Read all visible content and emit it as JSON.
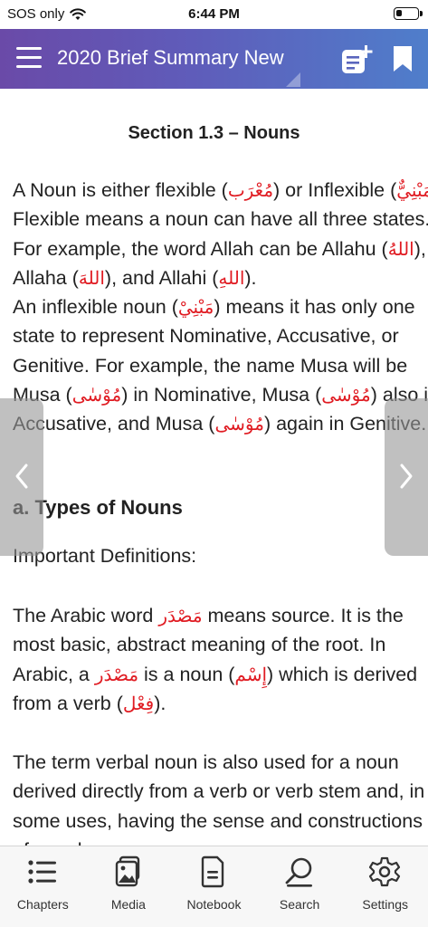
{
  "status": {
    "carrier": "SOS only",
    "time": "6:44 PM"
  },
  "header": {
    "title": "2020 Brief Summary New"
  },
  "content": {
    "section_title": "Section 1.3 – Nouns",
    "p1": [
      {
        "t": "A Noun is either flexible (",
        "ar": "مُعْرَب",
        "t2": ") or Inflexible (",
        "ar2": "مَبْنِيٌّ"
      },
      {
        "t": "Flexible means a noun can have all three states."
      },
      {
        "t": "For example, the word Allah can be Allahu (",
        "ar": "اللهُ",
        "t2": "),"
      },
      {
        "t": "Allaha (",
        "ar": "اللهَ",
        "t2": "), and Allahi (",
        "ar2": "اللهِ",
        "t3": ")."
      },
      {
        "t": "An inflexible noun (",
        "ar": "مَبْنِيْ",
        "t2": ") means it has only one"
      },
      {
        "t": "state to represent Nominative, Accusative, or"
      },
      {
        "t": "Genitive. For example, the name Musa will be"
      },
      {
        "t": "Musa (",
        "ar": "مُوْسٰى",
        "t2": ") in Nominative, Musa (",
        "ar2": "مُوْسٰى",
        "t3": ") also in"
      },
      {
        "t": "Accusative, and Musa (",
        "ar": "مُوْسٰى",
        "t2": ") again in Genitive."
      }
    ],
    "types_heading": "a. Types of Nouns",
    "important_defs": "Important Definitions:",
    "p2": [
      {
        "t": "The Arabic word ",
        "ar": "مَصْدَر",
        "t2": " means source. It is the"
      },
      {
        "t": "most basic, abstract meaning of the root. In"
      },
      {
        "t": "Arabic, a ",
        "ar": "مَصْدَر",
        "t2": " is a noun (",
        "ar2": "إِسْم",
        "t3": ") which is derived"
      },
      {
        "t": "from a verb (",
        "ar": "فِعْل",
        "t2": ")."
      }
    ],
    "p3": [
      {
        "t": "The term verbal noun is also used for a noun"
      },
      {
        "t": "derived directly from a verb or verb stem and, in"
      },
      {
        "t": "some uses, having the sense and constructions"
      },
      {
        "t": "of a verb."
      }
    ]
  },
  "tabs": [
    {
      "label": "Chapters"
    },
    {
      "label": "Media"
    },
    {
      "label": "Notebook"
    },
    {
      "label": "Search"
    },
    {
      "label": "Settings"
    }
  ],
  "colors": {
    "header_start": "#6a4aa8",
    "header_end": "#4f7ecb",
    "arabic": "#e01b22"
  },
  "battery_level": 0.25
}
